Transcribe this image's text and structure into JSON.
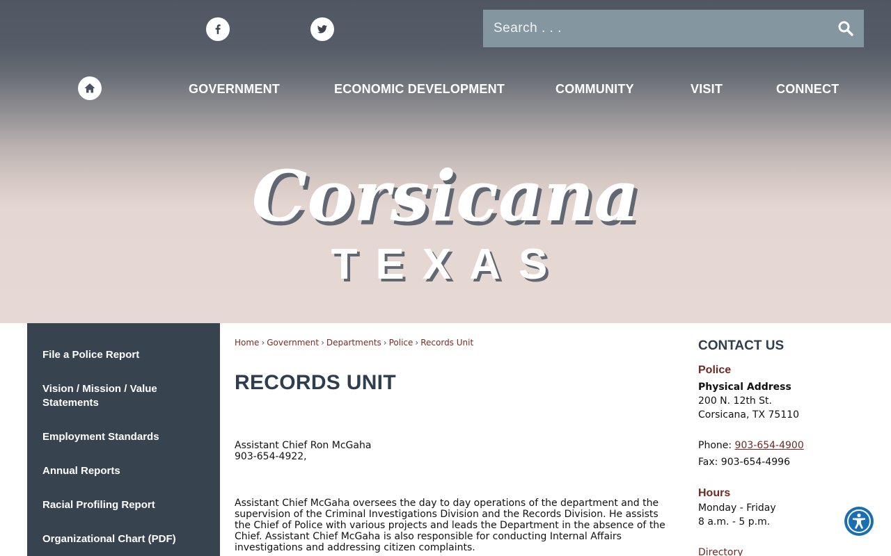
{
  "header": {
    "search_placeholder": "Search . . .",
    "nav": [
      "GOVERNMENT",
      "ECONOMIC DEVELOPMENT",
      "COMMUNITY",
      "VISIT",
      "CONNECT"
    ],
    "logo_script": "Corsicana",
    "logo_sub": "TEXAS"
  },
  "sidebar": {
    "items": [
      "File a Police Report",
      "Vision / Mission / Value Statements",
      "Employment Standards",
      "Annual Reports",
      "Racial Profiling Report",
      "Organizational Chart (PDF)"
    ]
  },
  "breadcrumb": [
    "Home",
    "Government",
    "Departments",
    "Police",
    "Records Unit"
  ],
  "main": {
    "title": "RECORDS UNIT",
    "person_name": "Assistant Chief Ron McGaha",
    "person_phone": "903-654-4922,",
    "description": "Assistant Chief McGaha oversees the day to day operations of the department and the supervision of the Criminal Investigations Division and the Records Division. He assists the Chief of Police with various projects and leads the Department in the absence of the Chief. Assistant Chief McGaha is also responsible for conducting Internal Affairs investigations and addressing citizen complaints."
  },
  "contact": {
    "title": "CONTACT US",
    "dept": "Police",
    "address_label": "Physical Address",
    "address_line1": "200 N. 12th St.",
    "address_line2": "Corsicana, TX 75110",
    "phone_label": "Phone:",
    "phone": "903-654-4900",
    "fax": "Fax: 903-654-4996",
    "hours_label": "Hours",
    "hours_days": "Monday - Friday",
    "hours_time": "8 a.m. - 5 p.m.",
    "directory": "Directory"
  },
  "colors": {
    "sidebar_bg": "#37434e",
    "accent_red": "#6e2a22",
    "title_navy": "#2e3e4e",
    "search_bg": "#8497a1",
    "accessibility_blue": "#1a6fb3"
  }
}
